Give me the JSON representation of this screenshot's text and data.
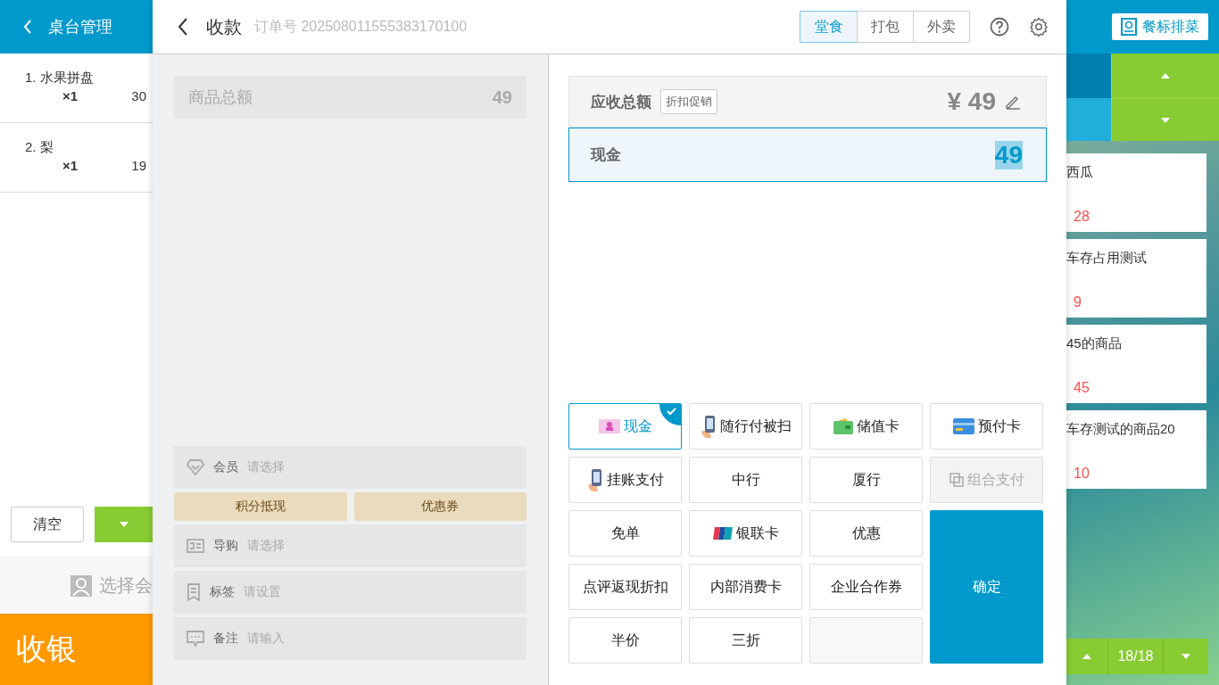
{
  "table_panel": {
    "title": "桌台管理",
    "items": [
      {
        "name": "1. 水果拼盘",
        "qty": "×1",
        "price": "30"
      },
      {
        "name": "2. 梨",
        "qty": "×1",
        "price": "19"
      }
    ],
    "clear_button": "清空",
    "member_hint": "选择会",
    "checkout": "收银"
  },
  "dialog": {
    "title": "收款",
    "order_no": "订单号 202508011555383170100",
    "modes": [
      {
        "label": "堂食",
        "selected": true
      },
      {
        "label": "打包",
        "selected": false
      },
      {
        "label": "外卖",
        "selected": false
      }
    ],
    "goods_total": {
      "label": "商品总额",
      "value": "49"
    },
    "fields": [
      {
        "kind": "member",
        "label": "会员",
        "placeholder": "请选择"
      },
      {
        "kind": "guide",
        "label": "导购",
        "placeholder": "请选择"
      },
      {
        "kind": "tag",
        "label": "标签",
        "placeholder": "请设置"
      },
      {
        "kind": "note",
        "label": "备注",
        "placeholder": "请输入"
      }
    ],
    "promo_buttons": [
      "积分抵现",
      "优惠券"
    ],
    "receivable": {
      "label": "应收总额",
      "discount": "折扣促销",
      "amount": "¥ 49"
    },
    "payment_line": {
      "label": "现金",
      "value": "49"
    },
    "methods": [
      {
        "kind": "cash",
        "label": "现金",
        "selected": true,
        "disabled": false
      },
      {
        "kind": "phone",
        "label": "随行付被扫",
        "selected": false,
        "disabled": false
      },
      {
        "kind": "wallet",
        "label": "储值卡",
        "selected": false,
        "disabled": false
      },
      {
        "kind": "card",
        "label": "预付卡",
        "selected": false,
        "disabled": false
      },
      {
        "kind": "phone",
        "label": "挂账支付",
        "selected": false,
        "disabled": false
      },
      {
        "kind": "plain",
        "label": "中行",
        "selected": false,
        "disabled": false
      },
      {
        "kind": "plain",
        "label": "厦行",
        "selected": false,
        "disabled": false
      },
      {
        "kind": "combo",
        "label": "组合支付",
        "selected": false,
        "disabled": true
      },
      {
        "kind": "plain",
        "label": "免单",
        "selected": false,
        "disabled": false
      },
      {
        "kind": "unionpay",
        "label": "银联卡",
        "selected": false,
        "disabled": false
      },
      {
        "kind": "plain",
        "label": "优惠",
        "selected": false,
        "disabled": false
      },
      {
        "kind": "plain",
        "label": "点评返现折扣",
        "selected": false,
        "disabled": false
      },
      {
        "kind": "plain",
        "label": "内部消费卡",
        "selected": false,
        "disabled": false
      },
      {
        "kind": "plain",
        "label": "企业合作券",
        "selected": false,
        "disabled": false
      },
      {
        "kind": "confirm",
        "label": "确定",
        "selected": false,
        "disabled": false
      },
      {
        "kind": "plain",
        "label": "半价",
        "selected": false,
        "disabled": false
      },
      {
        "kind": "plain",
        "label": "三折",
        "selected": false,
        "disabled": false
      },
      {
        "kind": "empty",
        "selected": false
      }
    ]
  },
  "menu_panel": {
    "button": "餐标排菜",
    "dishes": [
      {
        "name": "西瓜",
        "price": "28"
      },
      {
        "name": "车存占用测试",
        "price": "9"
      },
      {
        "name": "45的商品",
        "price": "45"
      },
      {
        "name": "车存测试的商品20",
        "price": "10"
      }
    ],
    "page": "18/18"
  }
}
